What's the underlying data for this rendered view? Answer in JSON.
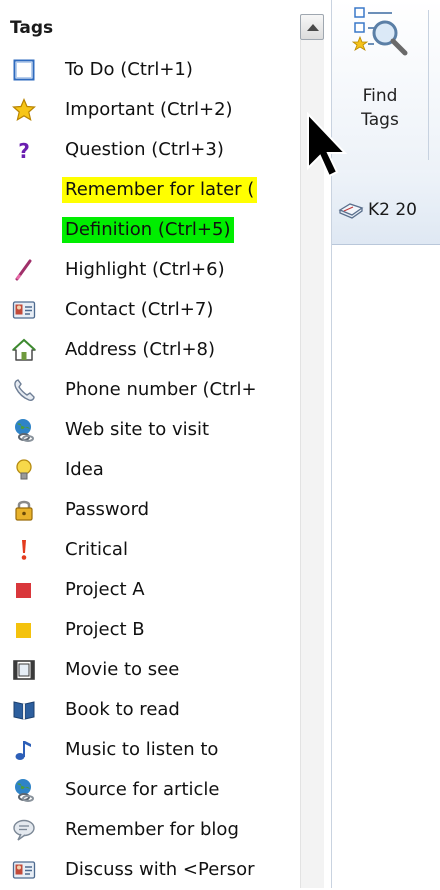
{
  "panel": {
    "title": "Tags"
  },
  "tags": [
    {
      "icon": "todo-checkbox-icon",
      "label": "To Do (Ctrl+1)"
    },
    {
      "icon": "star-icon",
      "label": "Important (Ctrl+2)"
    },
    {
      "icon": "question-mark-icon",
      "label": "Question (Ctrl+3)"
    },
    {
      "icon": "none",
      "label": "Remember for later (",
      "highlight": "#ffff00"
    },
    {
      "icon": "none",
      "label": "Definition (Ctrl+5)",
      "highlight": "#00ee00"
    },
    {
      "icon": "highlighter-pen-icon",
      "label": "Highlight (Ctrl+6)"
    },
    {
      "icon": "contact-card-icon",
      "label": "Contact (Ctrl+7)"
    },
    {
      "icon": "house-icon",
      "label": "Address (Ctrl+8)"
    },
    {
      "icon": "phone-icon",
      "label": "Phone number (Ctrl+"
    },
    {
      "icon": "globe-link-icon",
      "label": "Web site to visit"
    },
    {
      "icon": "lightbulb-icon",
      "label": "Idea"
    },
    {
      "icon": "padlock-icon",
      "label": "Password"
    },
    {
      "icon": "exclamation-icon",
      "label": "Critical"
    },
    {
      "icon": "red-square-icon",
      "label": "Project A"
    },
    {
      "icon": "yellow-square-icon",
      "label": "Project B"
    },
    {
      "icon": "film-icon",
      "label": "Movie to see"
    },
    {
      "icon": "book-icon",
      "label": "Book to read"
    },
    {
      "icon": "music-note-icon",
      "label": "Music to listen to"
    },
    {
      "icon": "globe-link-icon",
      "label": "Source for article"
    },
    {
      "icon": "speech-bubble-icon",
      "label": "Remember for blog"
    },
    {
      "icon": "contact-card-icon",
      "label": "Discuss with <Persor"
    }
  ],
  "ribbon": {
    "find_tags_line1": "Find",
    "find_tags_line2": "Tags"
  },
  "notebook_tab": {
    "label": "K2 20"
  },
  "colors": {
    "highlight_yellow": "#ffff00",
    "highlight_green": "#00ee00",
    "project_a": "#d9373b",
    "project_b": "#f4c20d"
  }
}
